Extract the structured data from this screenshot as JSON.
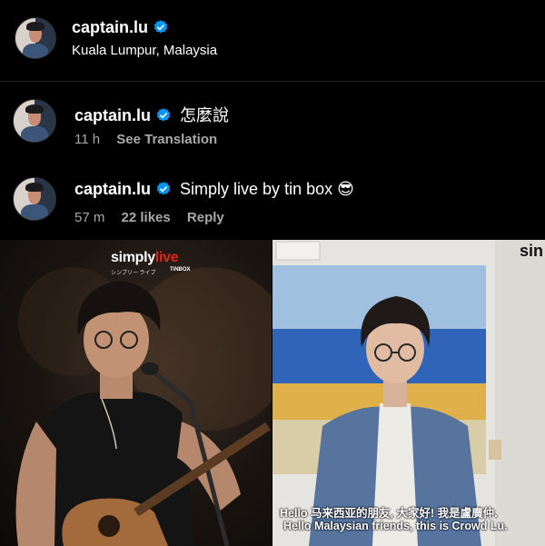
{
  "post_header": {
    "username": "captain.lu",
    "location": "Kuala Lumpur, Malaysia"
  },
  "comments": [
    {
      "username": "captain.lu",
      "text": "怎麼說",
      "time": "11 h",
      "action": "See Translation"
    },
    {
      "username": "captain.lu",
      "text": "Simply live by tin box 😎",
      "time": "57 m",
      "likes": "22 likes",
      "action": "Reply"
    }
  ],
  "media": {
    "left_brand_main": "simply",
    "left_brand_accent": "live",
    "left_brand_sub": "シンプリー ライブ",
    "left_brand_partner": "TiNBOX",
    "right_brand_partial": "sin",
    "subtitle_line1": "Hello 马来西亚的朋友, 大家好! 我是盧廣仲.",
    "subtitle_line2": "Hello Malaysian friends, this is Crowd Lu."
  },
  "colors": {
    "background": "#000000",
    "verified_badge": "#0095f6",
    "secondary_text": "#a8a8a8",
    "brand_accent": "#e2231a"
  },
  "icons": {
    "verified": "verified-badge-icon"
  }
}
